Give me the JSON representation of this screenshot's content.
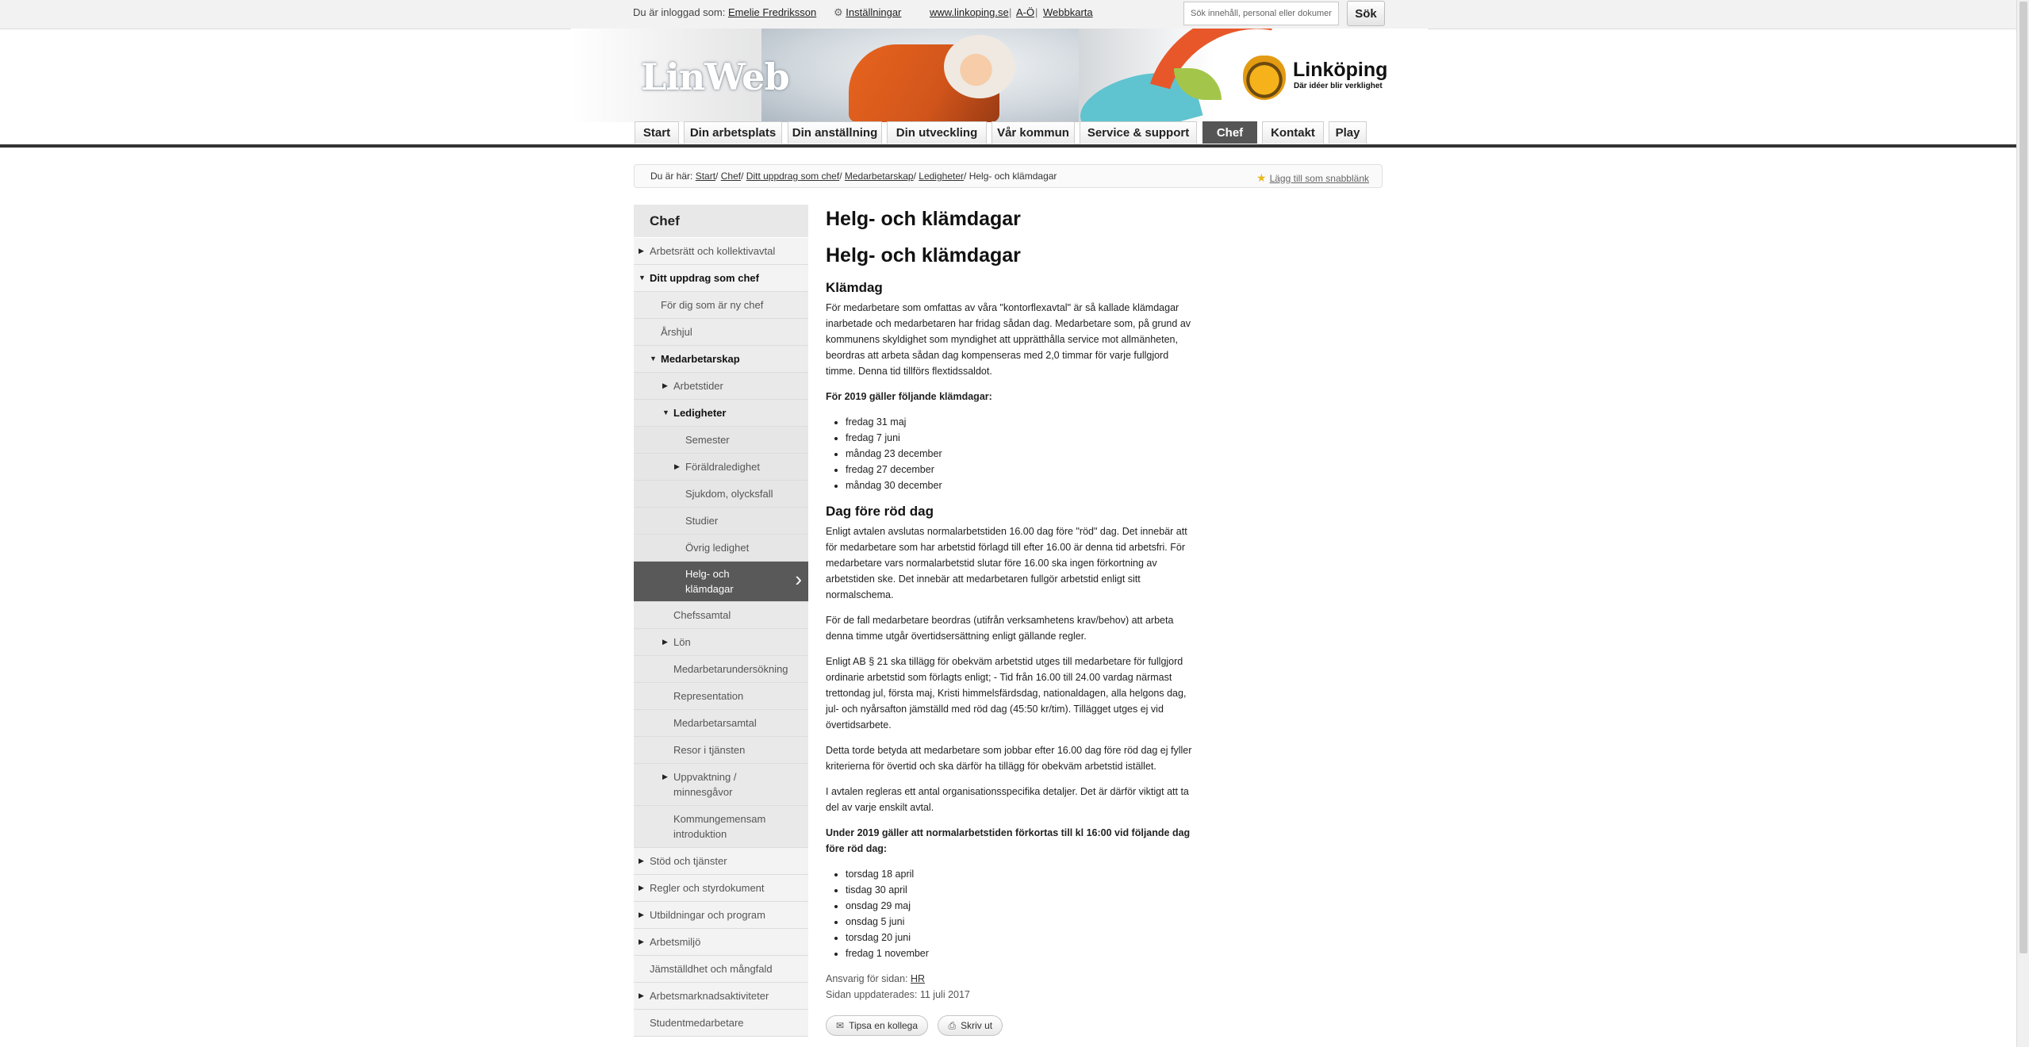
{
  "topbar": {
    "logged_in_prefix": "Du är inloggad som:",
    "user_name": "Emelie Fredriksson",
    "settings_label": "Inställningar",
    "site_link": "www.linkoping.se",
    "separator": "|",
    "az_label": "A-Ö",
    "webmap_label": "Webbkarta",
    "search_placeholder": "Sök innehåll, personal eller dokument",
    "search_button": "Sök"
  },
  "header": {
    "logo_text": "LinWeb",
    "city_name": "Linköping",
    "tagline": "Där idéer blir verklighet"
  },
  "nav": {
    "tabs": [
      {
        "label": "Start"
      },
      {
        "label": "Din arbetsplats"
      },
      {
        "label": "Din anställning"
      },
      {
        "label": "Din utveckling"
      },
      {
        "label": "Vår kommun"
      },
      {
        "label": "Service & support"
      },
      {
        "label": "Chef"
      },
      {
        "label": "Kontakt"
      },
      {
        "label": "Play"
      }
    ]
  },
  "breadcrumb": {
    "prefix": "Du är här:",
    "items": [
      "Start",
      "Chef",
      "Ditt uppdrag som chef",
      "Medarbetarskap",
      "Ledigheter"
    ],
    "current": "Helg- och klämdagar",
    "slash": "/",
    "add_favorite": "Lägg till som snabblänk"
  },
  "sidebar": {
    "title": "Chef",
    "items": [
      {
        "label": "Arbetsrätt och kollektivavtal",
        "arrow": "▶"
      },
      {
        "label": "Ditt uppdrag som chef",
        "arrow": "▼"
      },
      {
        "label": "För dig som är ny chef"
      },
      {
        "label": "Årshjul"
      },
      {
        "label": "Medarbetarskap",
        "arrow": "▼"
      },
      {
        "label": "Arbetstider",
        "arrow": "▶"
      },
      {
        "label": "Ledigheter",
        "arrow": "▼"
      },
      {
        "label": "Semester"
      },
      {
        "label": "Föräldraledighet",
        "arrow": "▶"
      },
      {
        "label": "Sjukdom, olycksfall"
      },
      {
        "label": "Studier"
      },
      {
        "label": "Övrig ledighet"
      },
      {
        "label": "Helg- och klämdagar",
        "chevron": "›"
      },
      {
        "label": "Chefssamtal"
      },
      {
        "label": "Lön",
        "arrow": "▶"
      },
      {
        "label": "Medarbetarundersökning"
      },
      {
        "label": "Representation"
      },
      {
        "label": "Medarbetarsamtal"
      },
      {
        "label": "Resor i tjänsten"
      },
      {
        "label": "Uppvaktning / minnesgåvor",
        "arrow": "▶"
      },
      {
        "label": "Kommungemensam introduktion"
      },
      {
        "label": "Stöd och tjänster",
        "arrow": "▶"
      },
      {
        "label": "Regler och styrdokument",
        "arrow": "▶"
      },
      {
        "label": "Utbildningar och program",
        "arrow": "▶"
      },
      {
        "label": "Arbetsmiljö",
        "arrow": "▶"
      },
      {
        "label": "Jämställdhet och mångfald"
      },
      {
        "label": "Arbetsmarknadsaktiviteter",
        "arrow": "▶"
      },
      {
        "label": "Studentmedarbetare"
      }
    ]
  },
  "content": {
    "page_title": "Helg- och klämdagar",
    "article_title": "Helg- och klämdagar",
    "section1_heading": "Klämdag",
    "section1_p1": "För medarbetare som omfattas av våra \"kontorflexavtal\" är så kallade klämdagar inarbetade och medarbetaren har fridag sådan dag. Medarbetare som, på grund av kommunens skyldighet som myndighet att upprätthålla service mot allmänheten, beordras att arbeta sådan dag kompenseras med 2,0 timmar för varje fullgjord timme. Denna tid tillförs flextidssaldot.",
    "section1_list_heading": "För 2019 gäller följande klämdagar:",
    "klamdagar": [
      "fredag 31 maj",
      "fredag 7 juni",
      "måndag 23 december",
      "fredag 27 december",
      "måndag 30 december"
    ],
    "section2_heading": "Dag före röd dag",
    "section2_p1": "Enligt avtalen avslutas normalarbetstiden 16.00 dag före \"röd\" dag. Det innebär att för medarbetare som har arbetstid förlagd till efter 16.00 är denna tid arbetsfri. För medarbetare vars normalarbetstid slutar före 16.00 ska ingen förkortning av arbetstiden ske. Det innebär att medarbetaren fullgör arbetstid enligt sitt normalschema.",
    "section2_p2": "För de fall medarbetare beordras (utifrån verksamhetens krav/behov) att arbeta denna timme utgår övertidsersättning enligt gällande regler.",
    "section2_p3": "Enligt AB § 21 ska tillägg för obekväm arbetstid utges till medarbetare för fullgjord ordinarie arbetstid som förlagts enligt; - Tid från 16.00 till 24.00 vardag närmast trettondag jul, första maj, Kristi himmelsfärdsdag, nationaldagen, alla helgons dag, jul- och nyårsafton jämställd med röd dag (45:50 kr/tim). Tillägget utges ej vid övertidsarbete.",
    "section2_p4": "Detta torde betyda att medarbetare som jobbar efter 16.00 dag före röd dag ej fyller kriterierna för övertid och ska därför ha tillägg för obekväm arbetstid istället.",
    "section2_p5": "I avtalen regleras ett antal organisationsspecifika detaljer. Det är därför viktigt att ta del av varje enskilt avtal.",
    "section2_list_heading": "Under 2019 gäller att normalarbetstiden förkortas till kl 16:00 vid följande dag före röd dag:",
    "rod_dagar": [
      "torsdag 18 april",
      "tisdag 30 april",
      "onsdag 29 maj",
      "onsdag 5 juni",
      "torsdag 20 juni",
      "fredag 1 november"
    ],
    "responsible_label": "Ansvarig för sidan:",
    "responsible_value": "HR",
    "updated_label": "Sidan uppdaterades:",
    "updated_value": "11 juli 2017",
    "tip_button": "Tipsa en kollega",
    "print_button": "Skriv ut"
  },
  "colors": {
    "active_tab": "#555555",
    "active_sidebar": "#595959",
    "nav_underline": "#333333",
    "favorite_star": "#e8b81f"
  },
  "icons": {
    "settings": "gear-icon",
    "favorite": "star-icon",
    "tip": "envelope-icon",
    "print": "printer-icon"
  }
}
